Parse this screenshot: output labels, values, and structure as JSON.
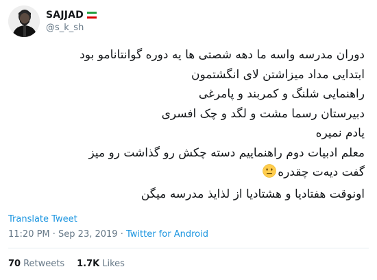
{
  "author": {
    "display_name": "SAJJAD",
    "username": "@s_k_sh",
    "flag_icon": "iran-flag-icon"
  },
  "tweet_lines": [
    "دوران مدرسه واسه ما دهه شصتی ها یه دوره گوانتانامو بود",
    "ابتدایی مداد میزاشتن لای انگشتمون",
    "راهنمایی شلنگ و کمربند و پامرغی",
    "دبیرستان رسما مشت و لگد و چک افسری",
    "یادم نمیره",
    "معلم ادبیات دوم راهنماییم دسته چکش رو گذاشت رو میز",
    "گفت دیه‌ت چقدره",
    "اونوقت هفتادیا و هشتادیا از لذایذ مدرسه میگن"
  ],
  "emoji": "neutral-face-icon",
  "translate_label": "Translate Tweet",
  "timestamp": "11:20 PM · Sep 23, 2019",
  "separator": " · ",
  "source": "Twitter for Android",
  "stats": {
    "retweets_count": "70",
    "retweets_label": "Retweets",
    "likes_count": "1.7K",
    "likes_label": "Likes"
  },
  "colors": {
    "link": "#1b95e0",
    "secondary": "#657786",
    "text": "#14171a"
  }
}
